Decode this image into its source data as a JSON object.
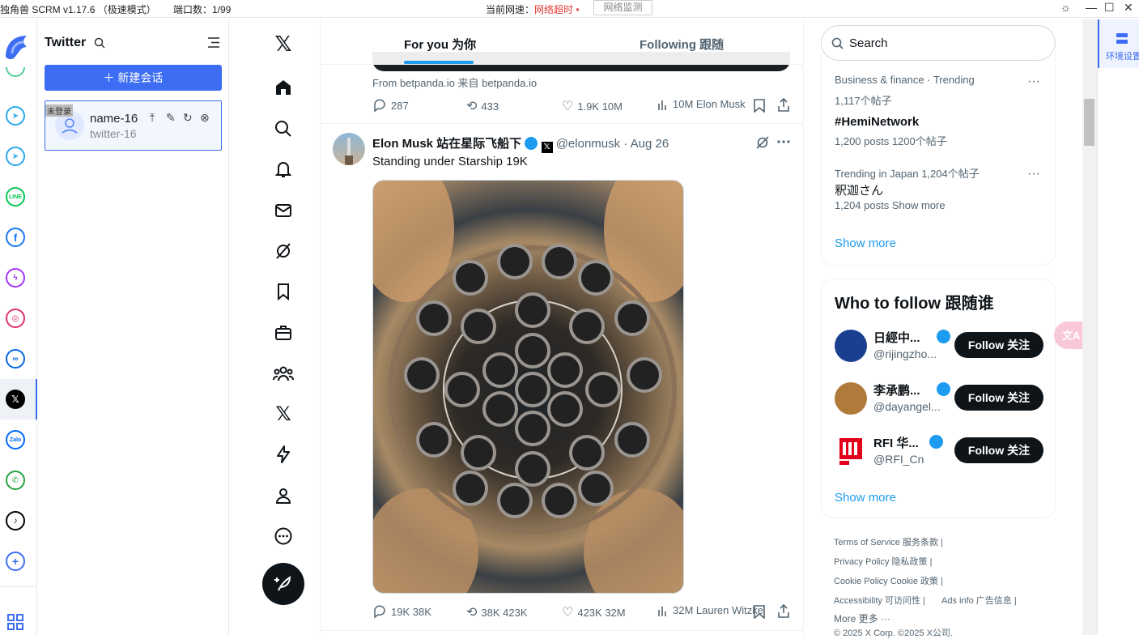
{
  "titlebar": {
    "app_name": "独角兽 SCRM v1.17.6 （极速模式）",
    "ports": "端口数：1/99",
    "speed_label": "当前网速：",
    "speed_status": "网络超时",
    "speed_dot": "•",
    "net_monitor": "网络监测"
  },
  "rail": {
    "apps": [
      "telegram",
      "telegram",
      "line",
      "facebook",
      "messenger",
      "instagram",
      "meta",
      "twitter",
      "zalo",
      "whatsapp-business",
      "tiktok",
      "add"
    ]
  },
  "sessions": {
    "title": "Twitter",
    "new_button": "＋ 新建会话",
    "card": {
      "tag": "未登录",
      "name": "name-16",
      "sub": "twitter-16"
    }
  },
  "feed": {
    "tab_for_you": "For you 为你",
    "tab_following": "Following 跟随",
    "ad": {
      "source": "From betpanda.io 来自 betpanda.io",
      "replies": "287",
      "reposts": "433",
      "likes": "1.9K 10M",
      "views": "10M Elon Musk"
    },
    "tweet": {
      "author": "Elon Musk 站在星际飞船下",
      "handle": "@elonmusk · Aug 26",
      "text": "Standing under Starship 19K",
      "replies": "19K 38K",
      "reposts": "38K 423K",
      "likes": "423K 32M",
      "views": "32M Lauren Witzke"
    }
  },
  "right": {
    "search_placeholder": "Search",
    "trends": [
      {
        "context": "Business & finance · Trending",
        "topic": "1,117个帖子",
        "count": ""
      },
      {
        "context": "",
        "topic": "#HemiNetwork",
        "count": "1,200 posts 1200个帖子"
      },
      {
        "context": "Trending in Japan 1,204个帖子",
        "topic": "釈迦さん",
        "count": "1,204 posts Show more"
      }
    ],
    "trends_show_more": "Show more",
    "who_to_follow_title": "Who to follow 跟随谁",
    "suggestions": [
      {
        "name": "日經中...",
        "handle": "@rijingzho...",
        "button": "Follow 关注"
      },
      {
        "name": "李承鹏...",
        "handle": "@dayangel...",
        "button": "Follow 关注"
      },
      {
        "name": "RFI 华...",
        "handle": "@RFI_Cn",
        "button": "Follow 关注"
      }
    ],
    "follow_show_more": "Show more",
    "footer": {
      "line1": "Terms of Service 服务条款  |",
      "line2": "Privacy Policy 隐私政策  |",
      "line3": "Cookie Policy Cookie 政策  |",
      "line4a": "Accessibility 可访问性  |",
      "line4b": "Ads info 广告信息  |",
      "line5": "More 更多 ···",
      "line6": "© 2025 X Corp. ©2025 X公司."
    }
  },
  "envbar": {
    "label": "环境设置"
  },
  "colors": {
    "accent": "#3d6df2",
    "x_blue": "#1d9bf0",
    "error": "#e53935"
  }
}
